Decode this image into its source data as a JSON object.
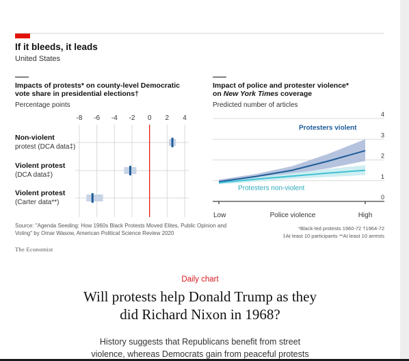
{
  "figure": {
    "title": "If it bleeds, it leads",
    "subtitle": "United States",
    "source": "Source: \"Agenda Seeding: How 1960s Black Protests Moved Elites, Public Opinion and Voting\" by Omar Wasow, American Political Science Review 2020",
    "notes": [
      "*Black-led protests 1960-72  †1964-72",
      "‡At least 10 participants  **At least 10 arrests"
    ],
    "brand": "The Economist"
  },
  "panel_left": {
    "title_line1": "Impacts of protests* on county-level Democratic",
    "title_line2": "vote share in presidential elections†",
    "subtitle": "Percentage points"
  },
  "panel_right": {
    "title_line1": "Impact of police and protester violence*",
    "title_line2_prefix": "on ",
    "title_line2_italic": "New York Times",
    "title_line2_suffix": " coverage",
    "subtitle": "Predicted number of articles"
  },
  "chart_data": [
    {
      "type": "scatter",
      "title": "Impacts of protests* on county-level Democratic vote share in presidential elections†",
      "xlabel": "Percentage points",
      "xlim": [
        -9,
        5
      ],
      "x_ticks": [
        -8,
        -6,
        -4,
        -2,
        0,
        2,
        4
      ],
      "reference_line": 0,
      "rows": [
        {
          "label1": "Non-violent",
          "label2": "protest (DCA data‡)",
          "value": 2.6,
          "ci": [
            2.2,
            3.0
          ]
        },
        {
          "label1": "Violent protest",
          "label2": "(DCA data‡)",
          "value": -2.2,
          "ci": [
            -2.9,
            -1.5
          ]
        },
        {
          "label1": "Violent protest",
          "label2": "(Carter data**)",
          "value": -6.5,
          "ci": [
            -7.2,
            -5.3
          ]
        }
      ],
      "colors": {
        "point": "#1f5c99",
        "band": "#c7d3e6",
        "reference": "#e3120b"
      }
    },
    {
      "type": "line",
      "title": "Impact of police and protester violence* on New York Times coverage",
      "ylabel": "Predicted number of articles",
      "xlabel": "Police violence",
      "x_tick_labels": [
        "Low",
        "High"
      ],
      "x": [
        0,
        0.25,
        0.5,
        0.75,
        1.0
      ],
      "ylim": [
        0,
        4
      ],
      "y_ticks": [
        0,
        1,
        2,
        3,
        4
      ],
      "series": [
        {
          "name": "Protesters violent",
          "values": [
            0.95,
            1.2,
            1.5,
            1.95,
            2.45
          ],
          "lower": [
            0.85,
            1.1,
            1.32,
            1.6,
            1.95
          ],
          "upper": [
            1.05,
            1.32,
            1.7,
            2.3,
            3.0
          ],
          "color": "#1f5c99",
          "band": "#a9b8d8"
        },
        {
          "name": "Protesters non-violent",
          "values": [
            0.9,
            1.07,
            1.22,
            1.37,
            1.5
          ],
          "lower": [
            0.82,
            0.95,
            1.08,
            1.18,
            1.27
          ],
          "upper": [
            0.98,
            1.17,
            1.37,
            1.57,
            1.75
          ],
          "color": "#3ec1d3",
          "band": "#c5ebf0"
        }
      ]
    }
  ],
  "article": {
    "category": "Daily chart",
    "headline_line1": "Will protests help Donald Trump as they",
    "headline_line2": "did Richard Nixon in 1968?",
    "standfirst_line1": "History suggests that Republicans benefit from street",
    "standfirst_line2": "violence, whereas Democrats gain from peaceful protests"
  }
}
